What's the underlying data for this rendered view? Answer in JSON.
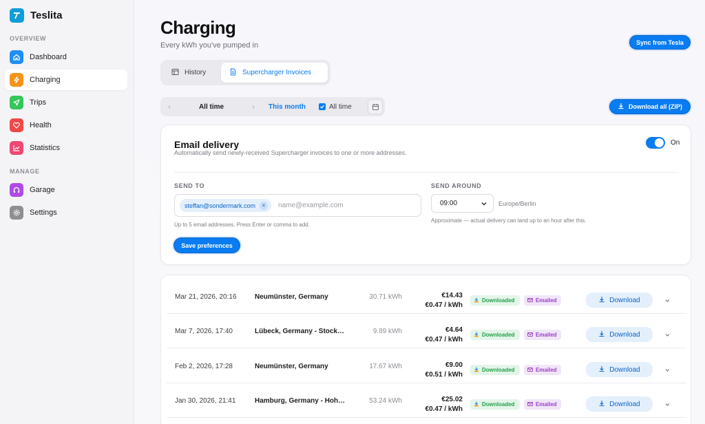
{
  "app": {
    "name": "Teslita"
  },
  "sidebar": {
    "overview_label": "OVERVIEW",
    "manage_label": "MANAGE",
    "overview_items": [
      {
        "label": "Dashboard",
        "icon": "home-icon",
        "color": "#1f8ef5"
      },
      {
        "label": "Charging",
        "icon": "bolt-icon",
        "color": "#f7931a"
      },
      {
        "label": "Trips",
        "icon": "navigation-icon",
        "color": "#34c759"
      },
      {
        "label": "Health",
        "icon": "heart-icon",
        "color": "#f04848"
      },
      {
        "label": "Statistics",
        "icon": "chart-icon",
        "color": "#f04870"
      }
    ],
    "manage_items": [
      {
        "label": "Garage",
        "icon": "garage-icon",
        "color": "#b04ae8"
      },
      {
        "label": "Settings",
        "icon": "gear-icon",
        "color": "#8e8e93"
      }
    ],
    "active": "Charging"
  },
  "header": {
    "title": "Charging",
    "subtitle": "Every kWh you've pumped in",
    "sync_label": "Sync from Tesla"
  },
  "tabs": [
    {
      "label": "History",
      "active": false
    },
    {
      "label": "Supercharger Invoices",
      "active": true
    }
  ],
  "datebar": {
    "prev": "‹",
    "current": "All time",
    "next": "›",
    "this_month": "This month",
    "all_time_checkbox": "All time",
    "all_time_checked": true
  },
  "download_all_label": "Download all (ZIP)",
  "email": {
    "title": "Email delivery",
    "description": "Automatically send newly-received Supercharger invoices to one or more addresses.",
    "toggle_label": "On",
    "toggle_on": true,
    "send_to_label": "SEND TO",
    "recipients": [
      "steffan@sondermark.com"
    ],
    "input_placeholder": "name@example.com",
    "send_to_help": "Up to 5 email addresses. Press Enter or comma to add.",
    "send_around_label": "SEND AROUND",
    "time_value": "09:00",
    "timezone": "Europe/Berlin",
    "send_around_help": "Approximate — actual delivery can land up to an hour after this.",
    "save_label": "Save preferences"
  },
  "invoices": {
    "downloaded_label": "Downloaded",
    "emailed_label": "Emailed",
    "download_label": "Download",
    "rows": [
      {
        "date": "Mar 21, 2026, 20:16",
        "location": "Neumünster, Germany",
        "kwh": "30.71 kWh",
        "total": "€14.43",
        "rate": "€0.47 / kWh"
      },
      {
        "date": "Mar 7, 2026, 17:40",
        "location": "Lübeck, Germany - Stockelsdorf",
        "kwh": "9.89 kWh",
        "total": "€4.64",
        "rate": "€0.47 / kWh"
      },
      {
        "date": "Feb 2, 2026, 17:28",
        "location": "Neumünster, Germany",
        "kwh": "17.67 kWh",
        "total": "€9.00",
        "rate": "€0.51 / kWh"
      },
      {
        "date": "Jan 30, 2026, 21:41",
        "location": "Hamburg, Germany - Hohenfelde",
        "kwh": "53.24 kWh",
        "total": "€25.02",
        "rate": "€0.47 / kWh"
      }
    ]
  }
}
